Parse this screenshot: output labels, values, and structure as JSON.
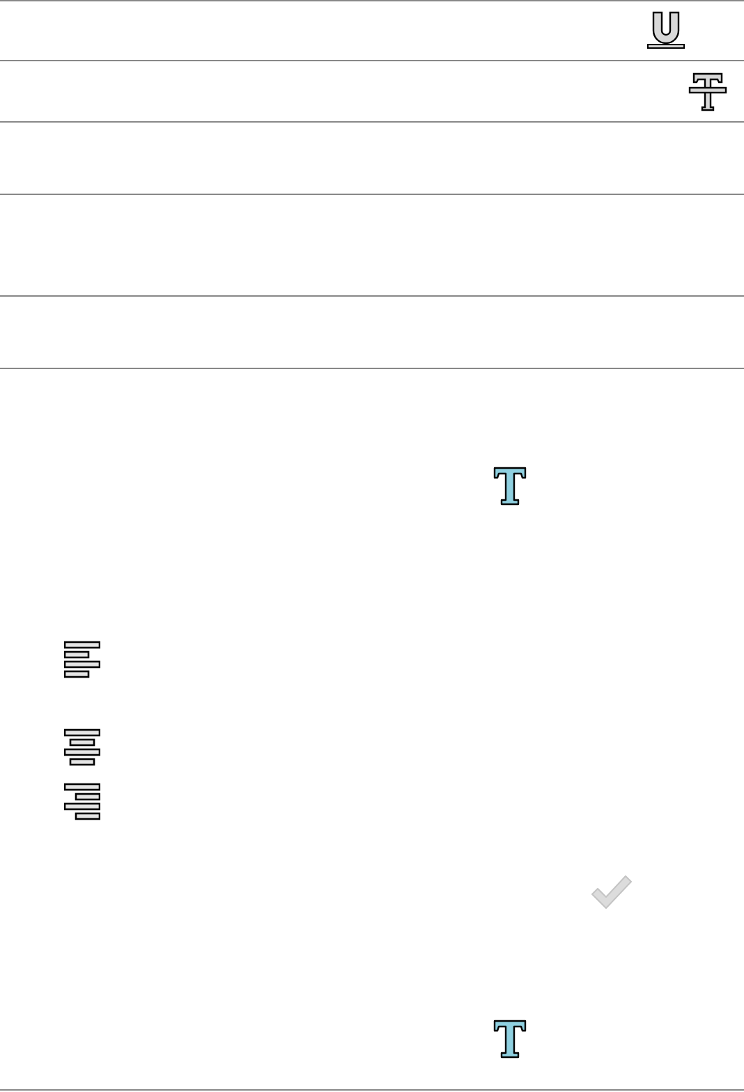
{
  "checkmark": {
    "disabled": true
  }
}
